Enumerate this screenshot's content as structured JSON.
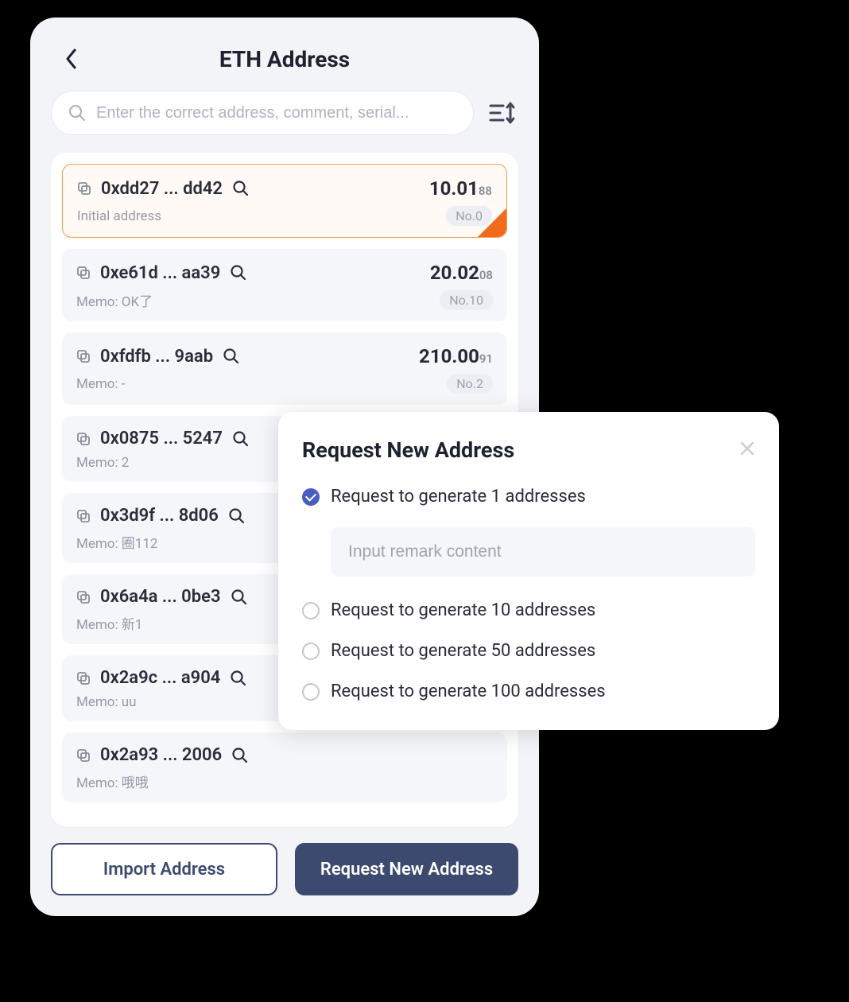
{
  "header": {
    "title": "ETH Address"
  },
  "search": {
    "placeholder": "Enter the correct address, comment, serial..."
  },
  "addresses": [
    {
      "addr": "0xdd27 ... dd42",
      "balance_main": "10.01",
      "balance_sub": "88",
      "memo": "Initial address",
      "badge": "No.0",
      "selected": true
    },
    {
      "addr": "0xe61d ... aa39",
      "balance_main": "20.02",
      "balance_sub": "08",
      "memo": "Memo: OK了",
      "badge": "No.10",
      "selected": false
    },
    {
      "addr": "0xfdfb ... 9aab",
      "balance_main": "210.00",
      "balance_sub": "91",
      "memo": "Memo: -",
      "badge": "No.2",
      "selected": false
    },
    {
      "addr": "0x0875 ... 5247",
      "balance_main": "",
      "balance_sub": "",
      "memo": "Memo: 2",
      "badge": "",
      "selected": false
    },
    {
      "addr": "0x3d9f ... 8d06",
      "balance_main": "",
      "balance_sub": "",
      "memo": "Memo: 圈112",
      "badge": "",
      "selected": false
    },
    {
      "addr": "0x6a4a ... 0be3",
      "balance_main": "",
      "balance_sub": "",
      "memo": "Memo: 新1",
      "badge": "",
      "selected": false
    },
    {
      "addr": "0x2a9c ... a904",
      "balance_main": "",
      "balance_sub": "",
      "memo": "Memo: uu",
      "badge": "",
      "selected": false
    },
    {
      "addr": "0x2a93 ... 2006",
      "balance_main": "",
      "balance_sub": "",
      "memo": "Memo: 哦哦",
      "badge": "",
      "selected": false
    }
  ],
  "footer": {
    "import_label": "Import Address",
    "request_label": "Request New Address"
  },
  "modal": {
    "title": "Request New Address",
    "options": [
      "Request to generate 1 addresses",
      "Request to generate 10 addresses",
      "Request to generate 50 addresses",
      "Request to generate 100 addresses"
    ],
    "selected_index": 0,
    "remark_placeholder": "Input remark content"
  }
}
